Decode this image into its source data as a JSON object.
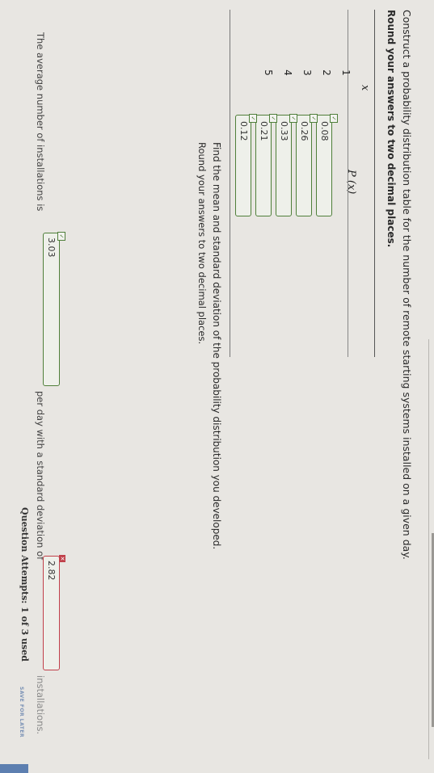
{
  "question": {
    "prompt": "Construct a probability distribution table for the number of remote starting systems installed on a given day.",
    "round_note": "Round your answers to two decimal places."
  },
  "table": {
    "col_x": "x",
    "col_px": "P (x)",
    "rows": [
      {
        "x": "1",
        "px": "0.08",
        "status": "correct"
      },
      {
        "x": "2",
        "px": "0.26",
        "status": "correct"
      },
      {
        "x": "3",
        "px": "0.33",
        "status": "correct"
      },
      {
        "x": "4",
        "px": "0.21",
        "status": "correct"
      },
      {
        "x": "5",
        "px": "0.12",
        "status": "correct"
      }
    ]
  },
  "part2": {
    "prompt": "Find the mean and standard deviation of the probability distribution you developed.",
    "round_note": "Round your answers to two decimal places.",
    "sentence_pre": "The average number of installations is",
    "mean_value": "3.03",
    "mean_status": "correct",
    "sentence_mid": "per day with a standard deviation of",
    "sd_value": "2.82",
    "sd_status": "incorrect",
    "sentence_post": "installations."
  },
  "footer": {
    "attempts": "Question Attempts: 1 of 3 used",
    "save_label": "SAVE FOR LATER"
  },
  "colors": {
    "correct": "#4f7f3a",
    "incorrect": "#c0404a",
    "link": "#5d7fb0"
  }
}
